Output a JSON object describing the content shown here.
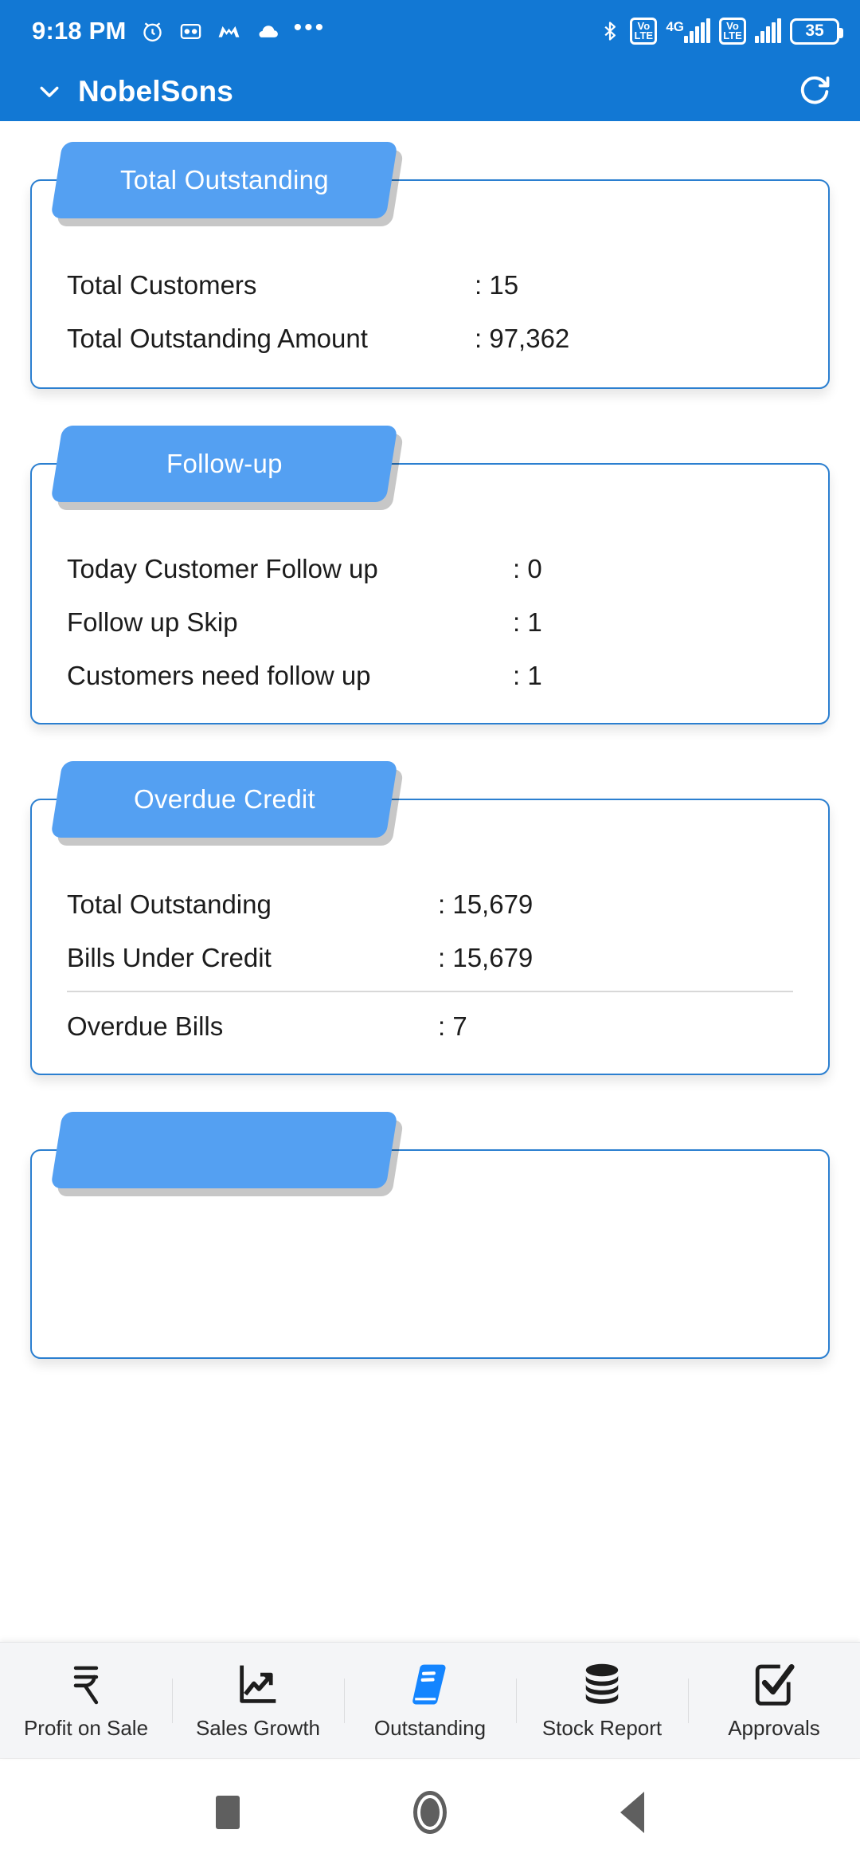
{
  "status_bar": {
    "time": "9:18 PM",
    "icons_left": [
      "alarm-icon",
      "voicemail-icon",
      "m-app-icon",
      "cloud-icon",
      "more-dots-icon"
    ],
    "bluetooth": "bluetooth-icon",
    "sim1_volte": "Vo LTE",
    "network_type": "4G",
    "sim2_volte": "Vo LTE",
    "battery_level": "35"
  },
  "app_bar": {
    "title": "NobelSons",
    "dropdown_icon": "chevron-down-icon",
    "refresh_icon": "refresh-icon"
  },
  "cards": [
    {
      "title": "Total Outstanding",
      "rows": [
        {
          "label": "Total Customers",
          "value": ": 15"
        },
        {
          "label": "Total Outstanding Amount",
          "value": ": 97,362"
        }
      ]
    },
    {
      "title": "Follow-up",
      "rows": [
        {
          "label": "Today Customer Follow up",
          "value": ": 0"
        },
        {
          "label": "Follow up Skip",
          "value": ": 1"
        },
        {
          "label": "Customers need follow up",
          "value": ": 1"
        }
      ]
    },
    {
      "title": "Overdue Credit",
      "rows": [
        {
          "label": "Total Outstanding",
          "value": ": 15,679"
        },
        {
          "label": "Bills Under Credit",
          "value": ": 15,679"
        },
        {
          "label": "Overdue Bills",
          "value": ": 7"
        }
      ]
    }
  ],
  "bottom_nav": {
    "items": [
      {
        "label": "Profit on Sale",
        "icon": "rupee-icon",
        "active": false
      },
      {
        "label": "Sales Growth",
        "icon": "growth-chart-icon",
        "active": false
      },
      {
        "label": "Outstanding",
        "icon": "book-icon",
        "active": true
      },
      {
        "label": "Stock Report",
        "icon": "coin-stack-icon",
        "active": false
      },
      {
        "label": "Approvals",
        "icon": "check-square-icon",
        "active": false
      }
    ]
  },
  "system_nav": {
    "recents": "recents-square-icon",
    "home": "home-circle-icon",
    "back": "back-triangle-icon"
  },
  "colors": {
    "app_bar": "#1278d4",
    "card_header": "#54a0f2",
    "card_border": "#2b7fd0",
    "accent": "#1485ff"
  }
}
